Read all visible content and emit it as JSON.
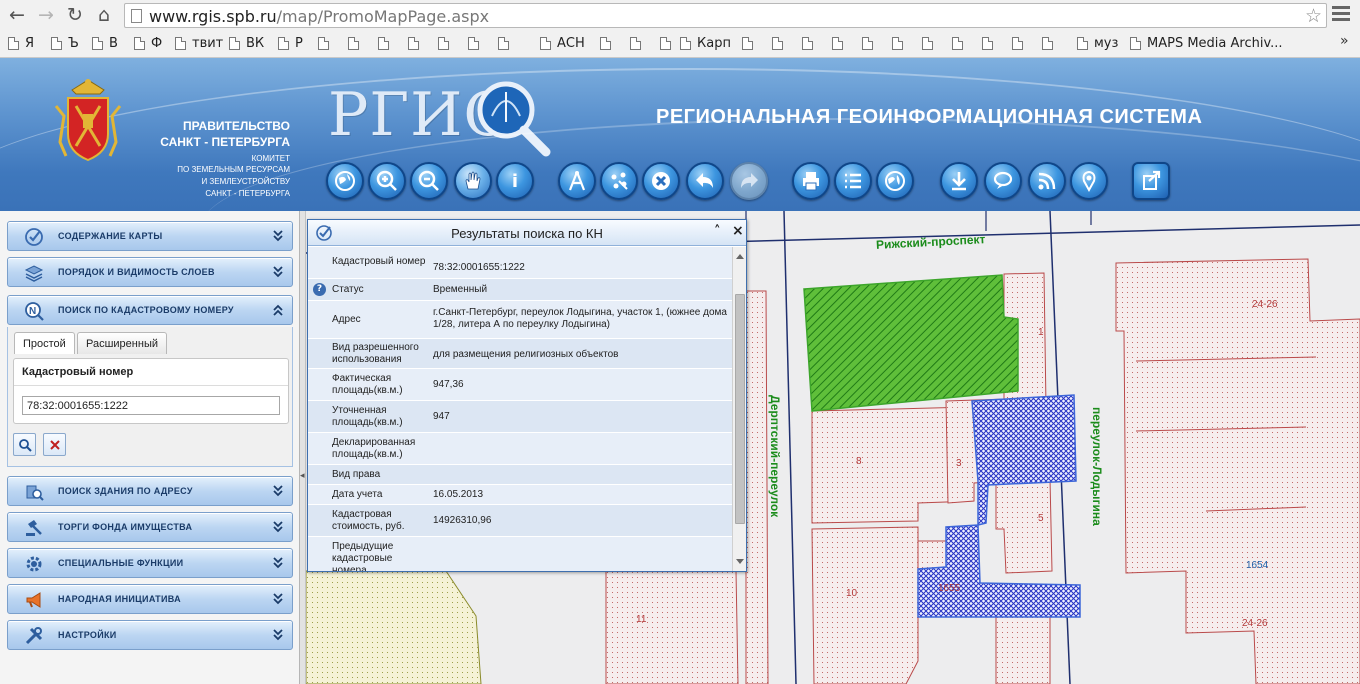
{
  "browser": {
    "url_host": "www.rgis.spb.ru",
    "url_path": "/map/PromoMapPage.aspx",
    "bookmarks": [
      "Я",
      "Ъ",
      "В",
      "Ф",
      "твит",
      "ВК",
      "Р",
      "АСН",
      "Карп",
      "муз",
      "MAPS Media Archiv..."
    ],
    "more": "»"
  },
  "header": {
    "gov_line1": "ПРАВИТЕЛЬСТВО",
    "gov_line2": "САНКТ - ПЕТЕРБУРГА",
    "committee1": "КОМИТЕТ",
    "committee2": "ПО ЗЕМЕЛЬНЫМ РЕСУРСАМ",
    "committee3": "И ЗЕМЛЕУСТРОЙСТВУ",
    "committee4": "САНКТ - ПЕТЕРБУРГА",
    "logo_text": "РГИС",
    "system_title": "РЕГИОНАЛЬНАЯ  ГЕОИНФОРМАЦИОННАЯ СИСТЕМА"
  },
  "toolbar": {
    "icons": [
      "globe-icon",
      "zoom-in-icon",
      "zoom-out-icon",
      "pan-hand-icon",
      "info-icon",
      "measure-icon",
      "select-points-icon",
      "clear-icon",
      "back-arrow-icon",
      "forward-arrow-icon",
      "print-icon",
      "list-icon",
      "world-icon",
      "download-icon",
      "comment-icon",
      "rss-icon",
      "location-pin-icon",
      "export-icon"
    ]
  },
  "left_panel": {
    "sections": [
      {
        "label": "Содержание карты",
        "icon": "check-circle-icon"
      },
      {
        "label": "Порядок и видимость слоев",
        "icon": "layers-icon"
      },
      {
        "label": "Поиск по кадастровому номеру",
        "icon": "cadastral-search-icon"
      },
      {
        "label": "Поиск здания по адресу",
        "icon": "building-search-icon"
      },
      {
        "label": "Торги фонда имущества",
        "icon": "auction-gavel-icon"
      },
      {
        "label": "Специальные функции",
        "icon": "gear-icon"
      },
      {
        "label": "Народная инициатива",
        "icon": "megaphone-icon"
      },
      {
        "label": "Настройки",
        "icon": "tools-icon"
      }
    ],
    "kad_search": {
      "tab_simple": "Простой",
      "tab_extended": "Расширенный",
      "field_label": "Кадастровый номер",
      "field_value": "78:32:0001655:1222"
    }
  },
  "dialog": {
    "title": "Результаты поиска по КН",
    "rows": [
      {
        "key": "Кадастровый номер",
        "value": "78:32:0001655:1222"
      },
      {
        "key": "Статус",
        "value": "Временный",
        "help": "?"
      },
      {
        "key": "Адрес",
        "value": "г.Санкт-Петербург, переулок Лодыгина, участок 1, (южнее дома 1/28, литера А по переулку Лодыгина)"
      },
      {
        "key": "Вид разрешенного использования",
        "value": "для размещения религиозных объектов"
      },
      {
        "key": "Фактическая площадь(кв.м.)",
        "value": "947,36"
      },
      {
        "key": "Уточненная площадь(кв.м.)",
        "value": "947"
      },
      {
        "key": "Декларированная площадь(кв.м.)",
        "value": ""
      },
      {
        "key": "Вид права",
        "value": ""
      },
      {
        "key": "Дата учета",
        "value": "16.05.2013"
      },
      {
        "key": "Кадастровая стоимость, руб.",
        "value": "14926310,96"
      },
      {
        "key": "Предыдущие кадастровые номера",
        "value": ""
      }
    ]
  },
  "map": {
    "streets": {
      "rizhsky": "Рижский-проспект",
      "derptsky": "Дерптский-переулок",
      "lodygina": "переулок-Лодыгина"
    },
    "labels": {
      "n1": "1",
      "n24_26_top": "24-26",
      "n8": "8",
      "n3": "3",
      "n5": "5",
      "n10": "10",
      "n11": "11",
      "n1655": "1655",
      "n1654": "1654",
      "n24_26_bottom": "24-26"
    },
    "colors": {
      "parcel_green": "#3da52b",
      "parcel_blue": "#2533c4",
      "parcel_red": "#b94a4a",
      "road": "#1f2f6e"
    }
  }
}
